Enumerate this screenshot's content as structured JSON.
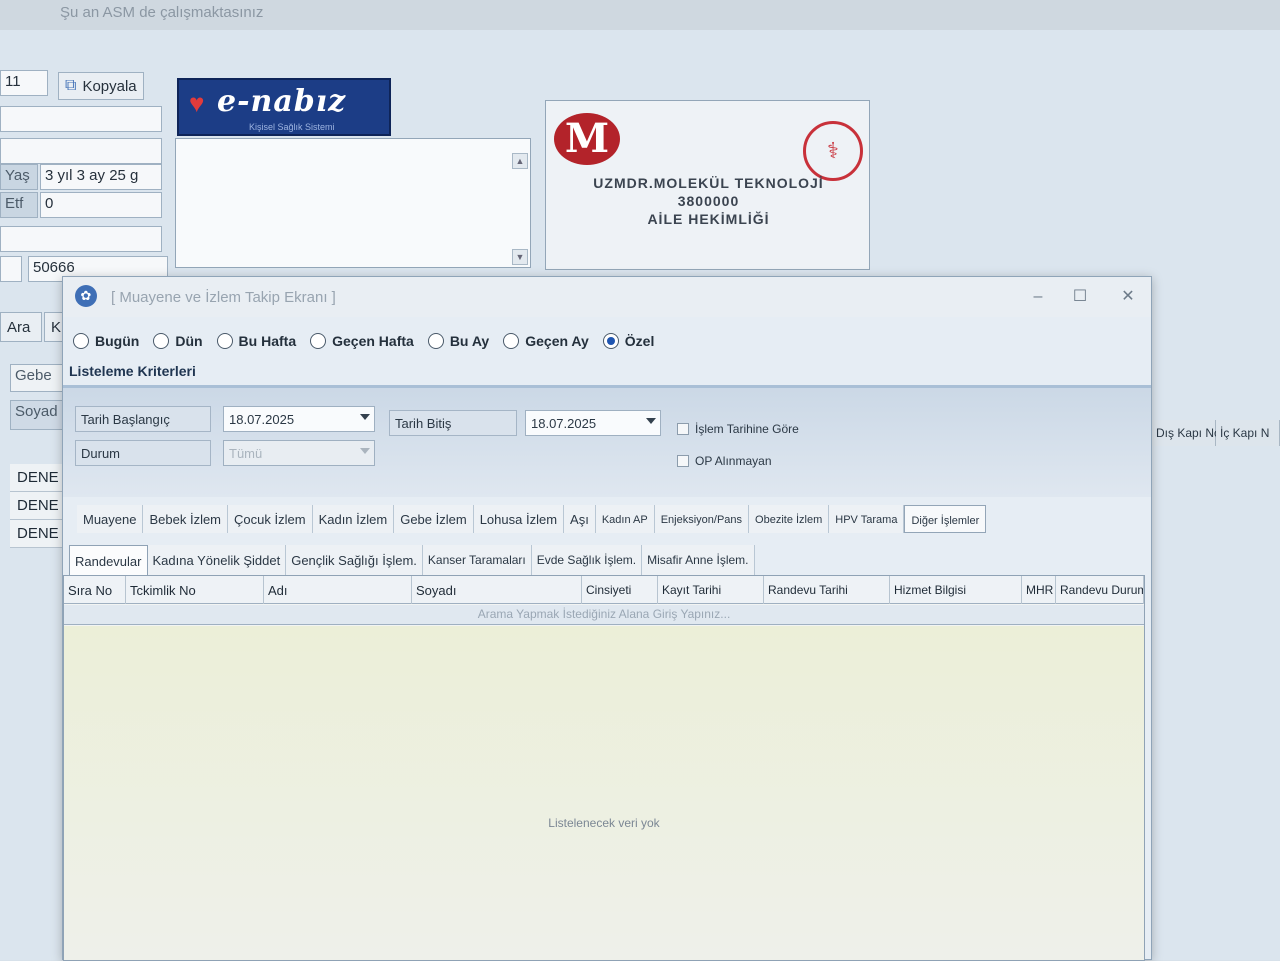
{
  "background_app": {
    "title": "Şu an ASM de çalışmaktasınız",
    "id_fragment": "11",
    "copy_button": "Kopyala",
    "age_label": "Yaş",
    "age_value": "3 yıl 3 ay 25 g",
    "etf_label": "Etf",
    "etf_value": "0",
    "phone_fragment": "50666",
    "search_label": "Ara",
    "k_label": "K",
    "gebe_label": "Gebe",
    "soyad_label": "Soyad",
    "rows": [
      "DENE",
      "DENE",
      "DENE"
    ],
    "right_headers": [
      "Dış Kapı No",
      "İç Kapı N"
    ],
    "enabiz": {
      "brand": "e-nabız",
      "tagline": "Kişisel Sağlık Sistemi"
    },
    "clinic": {
      "line1": "UZMDR.MOLEKÜL TEKNOLOJİ",
      "line2": "3800000",
      "line3": "AİLE HEKİMLİĞİ"
    }
  },
  "dialog": {
    "title": "[ Muayene ve İzlem Takip Ekranı ]",
    "periods": [
      {
        "label": "Bugün",
        "selected": false
      },
      {
        "label": "Dün",
        "selected": false
      },
      {
        "label": "Bu Hafta",
        "selected": false
      },
      {
        "label": "Geçen Hafta",
        "selected": false
      },
      {
        "label": "Bu Ay",
        "selected": false
      },
      {
        "label": "Geçen Ay",
        "selected": false
      },
      {
        "label": "Özel",
        "selected": true
      }
    ],
    "criteria_title": "Listeleme Kriterleri",
    "start_label": "Tarih Başlangıç",
    "start_value": "18.07.2025",
    "end_label": "Tarih Bitiş",
    "end_value": "18.07.2025",
    "status_label": "Durum",
    "status_value": "Tümü",
    "check_by_date": "İşlem Tarihine Göre",
    "check_op": "OP Alınmayan",
    "tabs_main": [
      "Muayene",
      "Bebek İzlem",
      "Çocuk İzlem",
      "Kadın İzlem",
      "Gebe İzlem",
      "Lohusa İzlem",
      "Aşı",
      "Kadın AP",
      "Enjeksiyon/Pans",
      "Obezite İzlem",
      "HPV Tarama",
      "Diğer İşlemler"
    ],
    "tabs_sub": [
      "Randevular",
      "Kadına Yönelik Şiddet",
      "Gençlik Sağlığı İşlem.",
      "Kanser Taramaları",
      "Evde Sağlık İşlem.",
      "Misafir Anne İşlem."
    ],
    "columns": [
      "Sıra No",
      "Tckimlik No",
      "Adı",
      "Soyadı",
      "Cinsiyeti",
      "Kayıt Tarihi",
      "Randevu Tarihi",
      "Hizmet Bilgisi",
      "MHR",
      "Randevu Durum"
    ],
    "search_hint": "Arama Yapmak İstediğiniz Alana Giriş Yapınız...",
    "empty_message": "Listelenecek veri yok"
  },
  "colors": {
    "selected_radio": "#1f55b0",
    "enabiz_blue": "#1c3d86",
    "clinic_red": "#b3232a"
  }
}
